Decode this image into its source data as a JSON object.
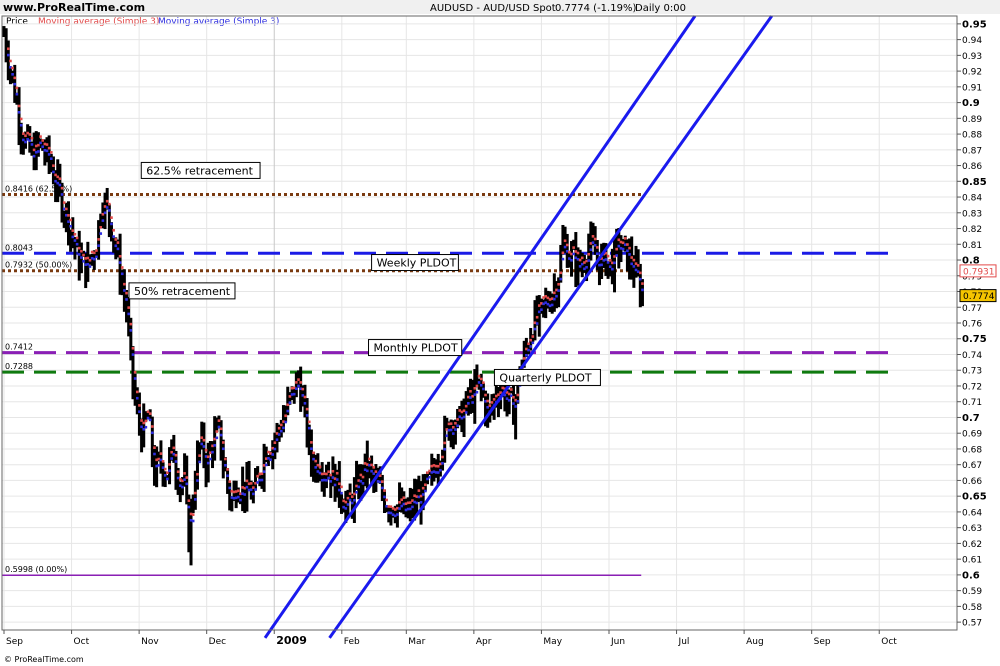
{
  "header": {
    "site": "www.ProRealTime.com",
    "instrument": "AUDUSD - AUD/USD Spot",
    "last_change": "0.7774 (-1.19%)",
    "period": "Daily 0:00"
  },
  "legend": {
    "price": "Price",
    "ma_red": "Moving average (Simple 3)",
    "ma_blue": "Moving average (Simple 3)"
  },
  "footer": {
    "copyright": "© ProRealTime.com"
  },
  "colors": {
    "ma_red": "#e24a4a",
    "ma_blue": "#2e2ee0",
    "channel": "#1a1aee",
    "weekly": "#1b1be6",
    "retracement": "#7a3a10",
    "monthly": "#8a1fb5",
    "quarterly": "#0f7a0f",
    "last_price_tag": "#f4c400",
    "ma_tag": "#e24a4a"
  },
  "chart_data": {
    "type": "bar",
    "title": "AUDUSD - AUD/USD Spot",
    "ylim": [
      0.565,
      0.955
    ],
    "y_ticks": [
      "0.57",
      "0.58",
      "0.59",
      "0.6",
      "0.61",
      "0.62",
      "0.63",
      "0.64",
      "0.65",
      "0.66",
      "0.67",
      "0.68",
      "0.69",
      "0.7",
      "0.71",
      "0.72",
      "0.73",
      "0.74",
      "0.75",
      "0.76",
      "0.77",
      "0.78",
      "0.79",
      "0.8",
      "0.81",
      "0.82",
      "0.83",
      "0.84",
      "0.85",
      "0.86",
      "0.87",
      "0.88",
      "0.89",
      "0.9",
      "0.91",
      "0.92",
      "0.93",
      "0.94",
      "0.95"
    ],
    "x_labels": [
      "Sep",
      "Oct",
      "Nov",
      "Dec",
      "2009",
      "Feb",
      "Mar",
      "Apr",
      "May",
      "Jun",
      "Jul",
      "Aug",
      "Sep",
      "Oct"
    ],
    "x_label_days": [
      0,
      44,
      88,
      132,
      176,
      220,
      262,
      306,
      350,
      394,
      438,
      482,
      526,
      570
    ],
    "series": [
      {
        "name": "Price",
        "kind": "ohlc",
        "color": "#000000",
        "close_path": [
          [
            0,
            0.943
          ],
          [
            6,
            0.912
          ],
          [
            12,
            0.88
          ],
          [
            18,
            0.866
          ],
          [
            24,
            0.873
          ],
          [
            30,
            0.862
          ],
          [
            36,
            0.842
          ],
          [
            42,
            0.825
          ],
          [
            48,
            0.802
          ],
          [
            54,
            0.795
          ],
          [
            60,
            0.81
          ],
          [
            64,
            0.84
          ],
          [
            70,
            0.822
          ],
          [
            76,
            0.79
          ],
          [
            80,
            0.768
          ],
          [
            82,
            0.74
          ],
          [
            86,
            0.705
          ],
          [
            90,
            0.69
          ],
          [
            94,
            0.7
          ],
          [
            98,
            0.665
          ],
          [
            102,
            0.672
          ],
          [
            106,
            0.665
          ],
          [
            110,
            0.68
          ],
          [
            114,
            0.66
          ],
          [
            118,
            0.66
          ],
          [
            120,
            0.62
          ],
          [
            124,
            0.66
          ],
          [
            128,
            0.685
          ],
          [
            132,
            0.67
          ],
          [
            136,
            0.685
          ],
          [
            140,
            0.69
          ],
          [
            144,
            0.665
          ],
          [
            148,
            0.645
          ],
          [
            152,
            0.66
          ],
          [
            156,
            0.655
          ],
          [
            160,
            0.652
          ],
          [
            164,
            0.653
          ],
          [
            170,
            0.68
          ],
          [
            176,
            0.685
          ],
          [
            180,
            0.695
          ],
          [
            186,
            0.71
          ],
          [
            192,
            0.725
          ],
          [
            196,
            0.7
          ],
          [
            200,
            0.672
          ],
          [
            206,
            0.67
          ],
          [
            212,
            0.665
          ],
          [
            218,
            0.655
          ],
          [
            224,
            0.642
          ],
          [
            230,
            0.655
          ],
          [
            236,
            0.67
          ],
          [
            240,
            0.66
          ],
          [
            246,
            0.652
          ],
          [
            250,
            0.645
          ],
          [
            256,
            0.644
          ],
          [
            262,
            0.638
          ],
          [
            268,
            0.648
          ],
          [
            272,
            0.65
          ],
          [
            278,
            0.66
          ],
          [
            284,
            0.68
          ],
          [
            288,
            0.69
          ],
          [
            292,
            0.7
          ],
          [
            296,
            0.695
          ],
          [
            300,
            0.705
          ],
          [
            306,
            0.715
          ],
          [
            310,
            0.72
          ],
          [
            316,
            0.7
          ],
          [
            320,
            0.715
          ],
          [
            324,
            0.72
          ],
          [
            328,
            0.71
          ],
          [
            332,
            0.705
          ],
          [
            336,
            0.73
          ],
          [
            340,
            0.742
          ],
          [
            344,
            0.76
          ],
          [
            348,
            0.762
          ],
          [
            352,
            0.77
          ],
          [
            356,
            0.778
          ],
          [
            360,
            0.785
          ],
          [
            364,
            0.81
          ],
          [
            368,
            0.804
          ],
          [
            372,
            0.8
          ],
          [
            376,
            0.795
          ],
          [
            380,
            0.81
          ],
          [
            384,
            0.805
          ],
          [
            388,
            0.798
          ],
          [
            392,
            0.8
          ],
          [
            396,
            0.795
          ],
          [
            400,
            0.81
          ],
          [
            404,
            0.805
          ],
          [
            408,
            0.8
          ],
          [
            412,
            0.79
          ],
          [
            416,
            0.7774
          ]
        ]
      },
      {
        "name": "Moving average (Simple 3)",
        "kind": "dots",
        "color": "#e24a4a"
      },
      {
        "name": "Moving average (Simple 3)",
        "kind": "dots",
        "color": "#2e2ee0"
      }
    ],
    "levels": [
      {
        "value": 0.8416,
        "label": "0.8416 (62.50%)",
        "style": "dotted",
        "color": "#7a3a10",
        "x_end_day": 415
      },
      {
        "value": 0.8043,
        "label": "0.8043",
        "style": "dashed",
        "color": "#1b1be6",
        "x_end_day": 580
      },
      {
        "value": 0.7932,
        "label": "0.7932 (50.00%)",
        "style": "dotted",
        "color": "#7a3a10",
        "x_end_day": 415
      },
      {
        "value": 0.7412,
        "label": "0.7412",
        "style": "dashed",
        "color": "#8a1fb5",
        "x_end_day": 580
      },
      {
        "value": 0.7288,
        "label": "0.7288",
        "style": "dashed",
        "color": "#0f7a0f",
        "x_end_day": 580
      },
      {
        "value": 0.5998,
        "label": "0.5998 (0.00%)",
        "style": "solid",
        "color": "#8a1fb5",
        "x_end_day": 415
      }
    ],
    "channel_lines": [
      {
        "from": [
          170,
          0.56
        ],
        "to": [
          450,
          0.955
        ]
      },
      {
        "from": [
          212,
          0.56
        ],
        "to": [
          500,
          0.955
        ]
      }
    ],
    "annotations": [
      {
        "text": "62.5% retracement",
        "day": 92,
        "y": 0.855,
        "boxed": true
      },
      {
        "text": "50% retracement",
        "day": 84,
        "y": 0.7785,
        "boxed": true
      },
      {
        "text": "Weekly PLDOT",
        "day": 242,
        "y": 0.7965,
        "boxed": true
      },
      {
        "text": "Monthly PLDOT",
        "day": 240,
        "y": 0.7425,
        "boxed": true
      },
      {
        "text": "Quarterly PLDOT",
        "day": 322,
        "y": 0.7235,
        "boxed": true
      }
    ],
    "price_tags": [
      {
        "text": "0.7931",
        "value": 0.7931,
        "style": "ma"
      },
      {
        "text": "0.7774",
        "value": 0.7774,
        "style": "last"
      }
    ]
  }
}
